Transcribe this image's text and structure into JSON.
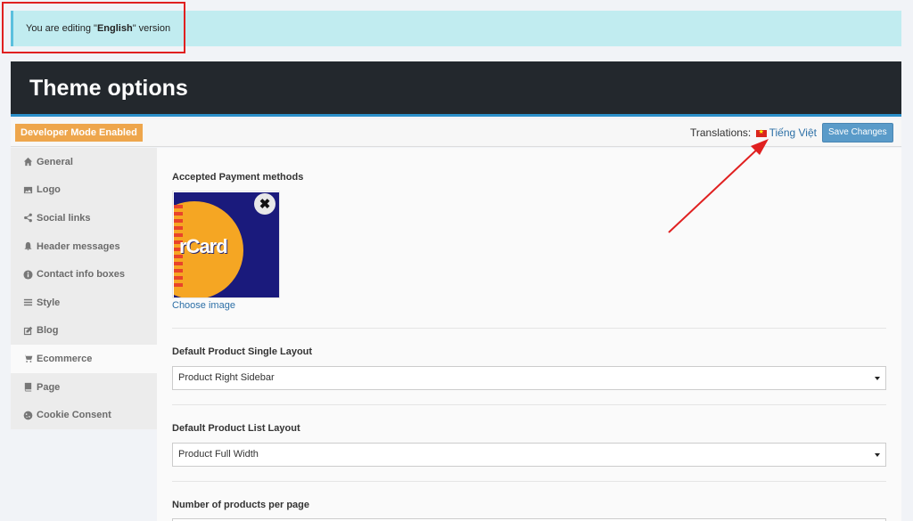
{
  "notice": {
    "prefix": "You are editing \"",
    "language": "English",
    "suffix": "\" version"
  },
  "header": {
    "title": "Theme options"
  },
  "toolbar": {
    "dev_badge": "Developer Mode Enabled",
    "translations_label": "Translations:",
    "translation_link": "Tiếng Việt",
    "save_label": "Save Changes"
  },
  "sidebar": {
    "items": [
      {
        "label": "General",
        "icon": "home-icon"
      },
      {
        "label": "Logo",
        "icon": "image-icon"
      },
      {
        "label": "Social links",
        "icon": "share-icon"
      },
      {
        "label": "Header messages",
        "icon": "bell-icon"
      },
      {
        "label": "Contact info boxes",
        "icon": "info-icon"
      },
      {
        "label": "Style",
        "icon": "bars-icon"
      },
      {
        "label": "Blog",
        "icon": "edit-icon"
      },
      {
        "label": "Ecommerce",
        "icon": "cart-icon",
        "active": true
      },
      {
        "label": "Page",
        "icon": "book-icon"
      },
      {
        "label": "Cookie Consent",
        "icon": "cookie-icon"
      }
    ]
  },
  "main": {
    "payment_label": "Accepted Payment methods",
    "card_text": "rCard",
    "choose_image": "Choose image",
    "single_layout_label": "Default Product Single Layout",
    "single_layout_value": "Product Right Sidebar",
    "list_layout_label": "Default Product List Layout",
    "list_layout_value": "Product Full Width",
    "per_page_label": "Number of products per page"
  },
  "colors": {
    "header_bg": "#23282d",
    "notice_bg": "#c1ecf0",
    "badge": "#eea64c",
    "save_btn": "#5a9bc9",
    "annotation": "#e02020"
  }
}
